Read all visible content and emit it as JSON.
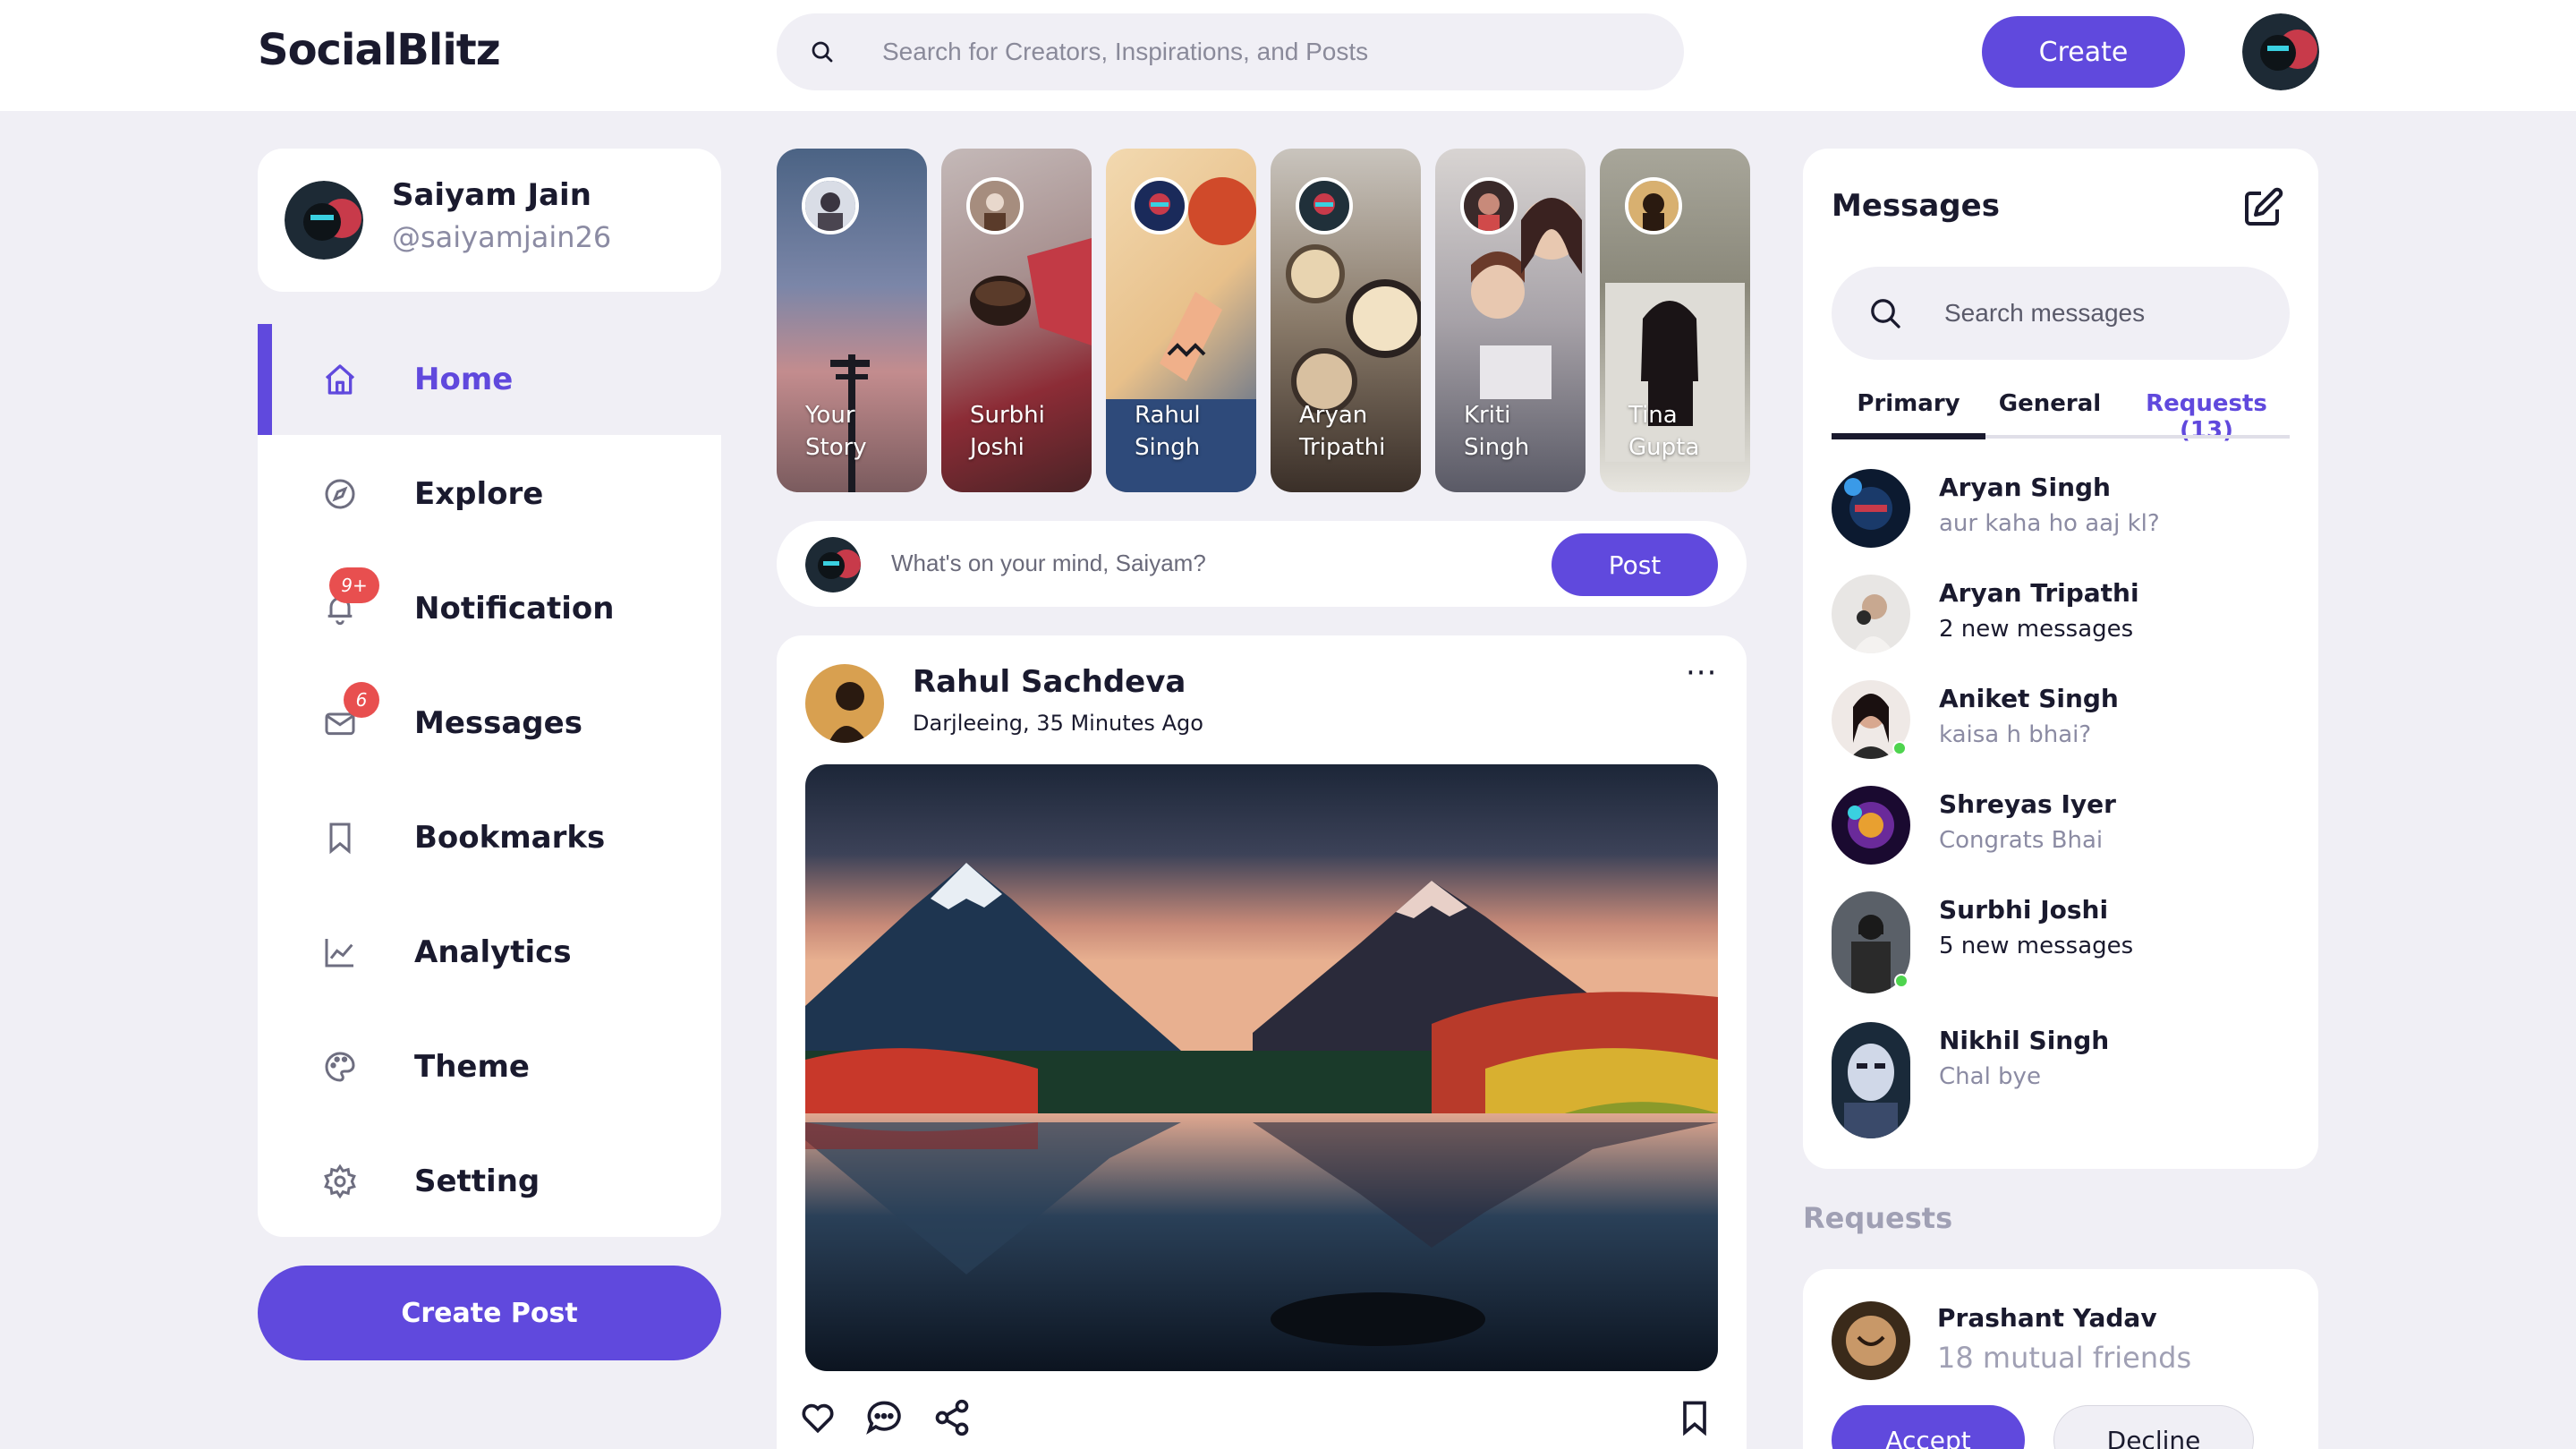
{
  "app": {
    "title": "SocialBlitz",
    "search_placeholder": "Search for Creators, Inspirations, and Posts",
    "create_label": "Create"
  },
  "colors": {
    "accent": "#6049dd",
    "background": "#f0eff5",
    "badge": "#e84f4f",
    "online": "#4ed44e"
  },
  "profile": {
    "name": "Saiyam Jain",
    "handle": "@saiyamjain26"
  },
  "sidebar": {
    "items": [
      {
        "label": "Home",
        "icon": "home-icon",
        "active": true
      },
      {
        "label": "Explore",
        "icon": "compass-icon"
      },
      {
        "label": "Notification",
        "icon": "bell-icon",
        "badge": "9+"
      },
      {
        "label": "Messages",
        "icon": "mail-icon",
        "badge": "6"
      },
      {
        "label": "Bookmarks",
        "icon": "bookmark-icon"
      },
      {
        "label": "Analytics",
        "icon": "chart-icon"
      },
      {
        "label": "Theme",
        "icon": "palette-icon"
      },
      {
        "label": "Setting",
        "icon": "gear-icon"
      }
    ],
    "create_post_label": "Create Post"
  },
  "stories": [
    {
      "first": "Your",
      "last": "Story"
    },
    {
      "first": "Surbhi",
      "last": "Joshi"
    },
    {
      "first": "Rahul",
      "last": "Singh"
    },
    {
      "first": "Aryan",
      "last": "Tripathi"
    },
    {
      "first": "Kriti",
      "last": "Singh"
    },
    {
      "first": "Tina",
      "last": "Gupta"
    }
  ],
  "composer": {
    "placeholder": "What's on your mind, Saiyam?",
    "post_label": "Post"
  },
  "post": {
    "author": "Rahul Sachdeva",
    "meta": "Darjleeing, 35 Minutes Ago",
    "more": "···"
  },
  "messages": {
    "title": "Messages",
    "search_placeholder": "Search messages",
    "tabs": [
      "Primary",
      "General",
      "Requests (13)"
    ],
    "items": [
      {
        "name": "Aryan Singh",
        "text": "aur kaha ho aaj kl?",
        "unread": false,
        "online": false
      },
      {
        "name": "Aryan Tripathi",
        "text": "2 new messages",
        "unread": true,
        "online": false
      },
      {
        "name": "Aniket Singh",
        "text": "kaisa h bhai?",
        "unread": false,
        "online": true
      },
      {
        "name": "Shreyas Iyer",
        "text": "Congrats Bhai",
        "unread": false,
        "online": false
      },
      {
        "name": "Surbhi Joshi",
        "text": "5 new messages",
        "unread": true,
        "online": true
      },
      {
        "name": "Nikhil Singh",
        "text": "Chal bye",
        "unread": false,
        "online": false
      }
    ]
  },
  "requests": {
    "title": "Requests",
    "name": "Prashant Yadav",
    "mutual": "18 mutual friends",
    "accept_label": "Accept",
    "decline_label": "Decline"
  }
}
